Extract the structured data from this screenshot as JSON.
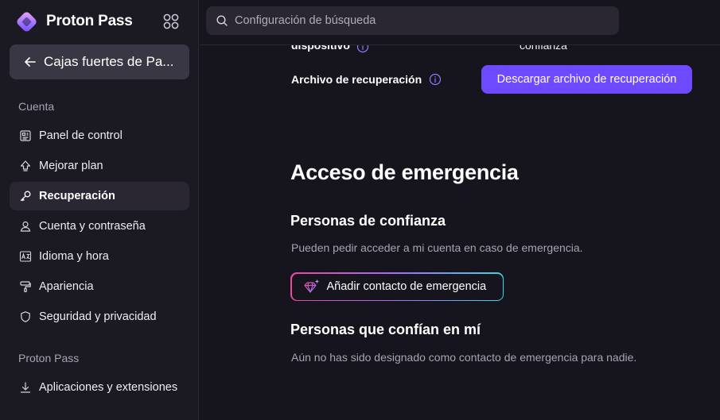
{
  "brand": {
    "name": "Proton Pass"
  },
  "back_button": {
    "label": "Cajas fuertes de Pa..."
  },
  "sidebar": {
    "sections": [
      {
        "label": "Cuenta",
        "items": [
          {
            "label": "Panel de control",
            "icon": "dashboard-icon"
          },
          {
            "label": "Mejorar plan",
            "icon": "upgrade-icon"
          },
          {
            "label": "Recuperación",
            "icon": "key-icon",
            "active": true
          },
          {
            "label": "Cuenta y contraseña",
            "icon": "user-icon"
          },
          {
            "label": "Idioma y hora",
            "icon": "language-icon"
          },
          {
            "label": "Apariencia",
            "icon": "paint-roller-icon"
          },
          {
            "label": "Seguridad y privacidad",
            "icon": "shield-icon"
          }
        ]
      },
      {
        "label": "Proton Pass",
        "items": [
          {
            "label": "Aplicaciones y extensiones",
            "icon": "download-icon"
          }
        ]
      }
    ]
  },
  "search": {
    "placeholder": "Configuración de búsqueda"
  },
  "main": {
    "clipped_row": {
      "label": "dispositivo",
      "value": "confianza"
    },
    "recovery_file": {
      "label": "Archivo de recuperación",
      "button": "Descargar archivo de recuperación"
    },
    "emergency": {
      "title": "Acceso de emergencia",
      "trusted_title": "Personas de confianza",
      "trusted_desc": "Pueden pedir acceder a mi cuenta en caso de emergencia.",
      "add_button": "Añadir contacto de emergencia",
      "trusting_title": "Personas que confían en mí",
      "trusting_desc": "Aún no has sido designado como contacto de emergencia para nadie."
    }
  },
  "colors": {
    "accent": "#6d4aff",
    "background": "#16141c",
    "sidebar": "#1b1922",
    "muted_text": "#a7a4b3"
  }
}
